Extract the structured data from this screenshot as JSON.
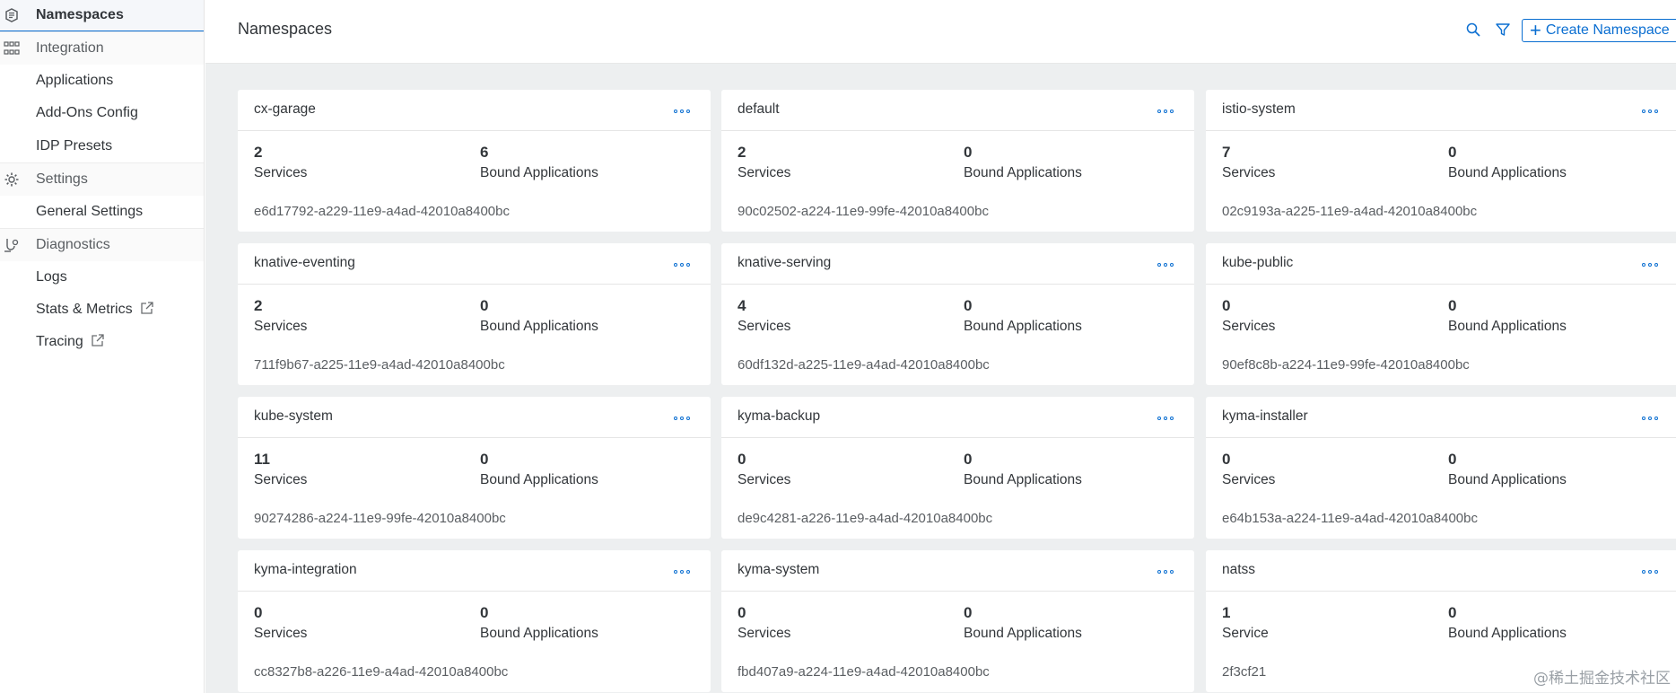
{
  "sidebar": {
    "items": [
      {
        "label": "Namespaces",
        "type": "active",
        "icon": "namespace-icon"
      },
      {
        "label": "Integration",
        "type": "category",
        "icon": "integration-icon"
      },
      {
        "label": "Applications",
        "type": "item"
      },
      {
        "label": "Add-Ons Config",
        "type": "item"
      },
      {
        "label": "IDP Presets",
        "type": "item"
      },
      {
        "label": "Settings",
        "type": "category",
        "icon": "gear-icon"
      },
      {
        "label": "General Settings",
        "type": "item"
      },
      {
        "label": "Diagnostics",
        "type": "category",
        "icon": "diagnostics-icon"
      },
      {
        "label": "Logs",
        "type": "item"
      },
      {
        "label": "Stats & Metrics",
        "type": "item",
        "external": true
      },
      {
        "label": "Tracing",
        "type": "item",
        "external": true
      }
    ]
  },
  "header": {
    "title": "Namespaces",
    "create_label": "Create Namespace"
  },
  "namespaces": [
    {
      "name": "cx-garage",
      "services": "2",
      "services_label": "Services",
      "bound": "6",
      "bound_label": "Bound Applications",
      "uid": "e6d17792-a229-11e9-a4ad-42010a8400bc"
    },
    {
      "name": "default",
      "services": "2",
      "services_label": "Services",
      "bound": "0",
      "bound_label": "Bound Applications",
      "uid": "90c02502-a224-11e9-99fe-42010a8400bc"
    },
    {
      "name": "istio-system",
      "services": "7",
      "services_label": "Services",
      "bound": "0",
      "bound_label": "Bound Applications",
      "uid": "02c9193a-a225-11e9-a4ad-42010a8400bc"
    },
    {
      "name": "knative-eventing",
      "services": "2",
      "services_label": "Services",
      "bound": "0",
      "bound_label": "Bound Applications",
      "uid": "711f9b67-a225-11e9-a4ad-42010a8400bc"
    },
    {
      "name": "knative-serving",
      "services": "4",
      "services_label": "Services",
      "bound": "0",
      "bound_label": "Bound Applications",
      "uid": "60df132d-a225-11e9-a4ad-42010a8400bc"
    },
    {
      "name": "kube-public",
      "services": "0",
      "services_label": "Services",
      "bound": "0",
      "bound_label": "Bound Applications",
      "uid": "90ef8c8b-a224-11e9-99fe-42010a8400bc"
    },
    {
      "name": "kube-system",
      "services": "11",
      "services_label": "Services",
      "bound": "0",
      "bound_label": "Bound Applications",
      "uid": "90274286-a224-11e9-99fe-42010a8400bc"
    },
    {
      "name": "kyma-backup",
      "services": "0",
      "services_label": "Services",
      "bound": "0",
      "bound_label": "Bound Applications",
      "uid": "de9c4281-a226-11e9-a4ad-42010a8400bc"
    },
    {
      "name": "kyma-installer",
      "services": "0",
      "services_label": "Services",
      "bound": "0",
      "bound_label": "Bound Applications",
      "uid": "e64b153a-a224-11e9-a4ad-42010a8400bc"
    },
    {
      "name": "kyma-integration",
      "services": "0",
      "services_label": "Services",
      "bound": "0",
      "bound_label": "Bound Applications",
      "uid": "cc8327b8-a226-11e9-a4ad-42010a8400bc"
    },
    {
      "name": "kyma-system",
      "services": "0",
      "services_label": "Services",
      "bound": "0",
      "bound_label": "Bound Applications",
      "uid": "fbd407a9-a224-11e9-a4ad-42010a8400bc"
    },
    {
      "name": "natss",
      "services": "1",
      "services_label": "Service",
      "bound": "0",
      "bound_label": "Bound Applications",
      "uid": "2f3cf21"
    }
  ],
  "watermark": "@稀土掘金技术社区",
  "colors": {
    "accent": "#0a6ed1",
    "background": "#edeff0",
    "text": "#32363a"
  }
}
